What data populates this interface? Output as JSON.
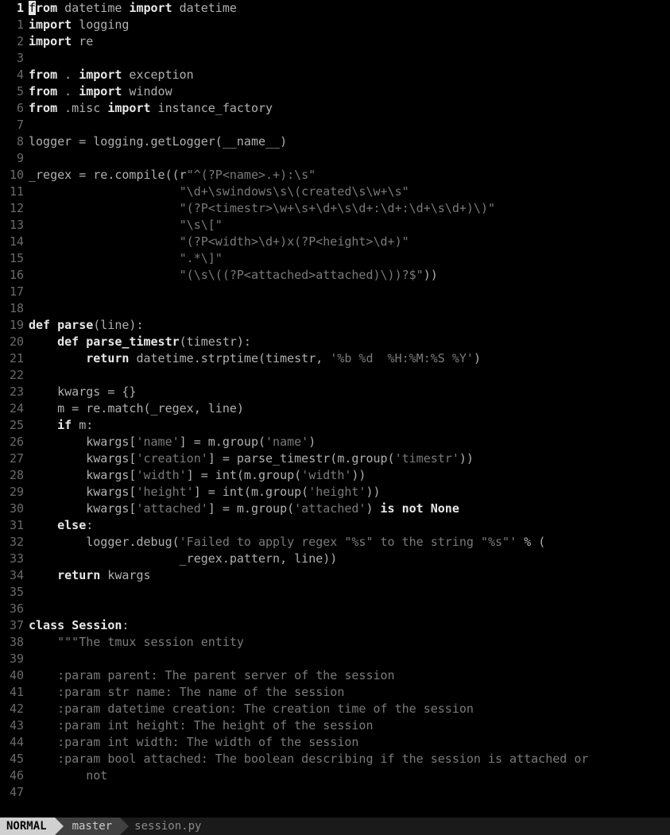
{
  "status": {
    "mode": "NORMAL",
    "branch_icon": "",
    "branch": "master",
    "filename": "session.py"
  },
  "cursor": {
    "line": 1,
    "col": 1
  },
  "lines": [
    {
      "num": 1,
      "current": true,
      "tokens": [
        {
          "c": "cursor",
          "t": "f"
        },
        {
          "c": "kw",
          "t": "rom"
        },
        {
          "c": "pun",
          "t": " datetime "
        },
        {
          "c": "kw",
          "t": "import"
        },
        {
          "c": "pun",
          "t": " datetime"
        }
      ]
    },
    {
      "num": 1,
      "tokens": [
        {
          "c": "kw",
          "t": "import"
        },
        {
          "c": "pun",
          "t": " logging"
        }
      ]
    },
    {
      "num": 2,
      "tokens": [
        {
          "c": "kw",
          "t": "import"
        },
        {
          "c": "pun",
          "t": " re"
        }
      ]
    },
    {
      "num": 3,
      "tokens": []
    },
    {
      "num": 4,
      "tokens": [
        {
          "c": "kw",
          "t": "from"
        },
        {
          "c": "pun",
          "t": " . "
        },
        {
          "c": "kw",
          "t": "import"
        },
        {
          "c": "pun",
          "t": " exception"
        }
      ]
    },
    {
      "num": 5,
      "tokens": [
        {
          "c": "kw",
          "t": "from"
        },
        {
          "c": "pun",
          "t": " . "
        },
        {
          "c": "kw",
          "t": "import"
        },
        {
          "c": "pun",
          "t": " window"
        }
      ]
    },
    {
      "num": 6,
      "tokens": [
        {
          "c": "kw",
          "t": "from"
        },
        {
          "c": "pun",
          "t": " .misc "
        },
        {
          "c": "kw",
          "t": "import"
        },
        {
          "c": "pun",
          "t": " instance_factory"
        }
      ]
    },
    {
      "num": 7,
      "tokens": []
    },
    {
      "num": 8,
      "tokens": [
        {
          "c": "id",
          "t": "logger = logging.getLogger(__name__)"
        }
      ]
    },
    {
      "num": 9,
      "tokens": []
    },
    {
      "num": 10,
      "tokens": [
        {
          "c": "id",
          "t": "_regex = re.compile((r"
        },
        {
          "c": "str",
          "t": "\"^(?P<name>.+):\\s\""
        }
      ]
    },
    {
      "num": 11,
      "tokens": [
        {
          "c": "id",
          "t": "                     "
        },
        {
          "c": "str",
          "t": "\"\\d+\\swindows\\s\\(created\\s\\w+\\s\""
        }
      ]
    },
    {
      "num": 12,
      "tokens": [
        {
          "c": "id",
          "t": "                     "
        },
        {
          "c": "str",
          "t": "\"(?P<timestr>\\w+\\s+\\d+\\s\\d+:\\d+:\\d+\\s\\d+)\\)\""
        }
      ]
    },
    {
      "num": 13,
      "tokens": [
        {
          "c": "id",
          "t": "                     "
        },
        {
          "c": "str",
          "t": "\"\\s\\[\""
        }
      ]
    },
    {
      "num": 14,
      "tokens": [
        {
          "c": "id",
          "t": "                     "
        },
        {
          "c": "str",
          "t": "\"(?P<width>\\d+)x(?P<height>\\d+)\""
        }
      ]
    },
    {
      "num": 15,
      "tokens": [
        {
          "c": "id",
          "t": "                     "
        },
        {
          "c": "str",
          "t": "\".*\\]\""
        }
      ]
    },
    {
      "num": 16,
      "tokens": [
        {
          "c": "id",
          "t": "                     "
        },
        {
          "c": "str",
          "t": "\"(\\s\\((?P<attached>attached)\\))?$\""
        },
        {
          "c": "id",
          "t": "))"
        }
      ]
    },
    {
      "num": 17,
      "tokens": []
    },
    {
      "num": 18,
      "tokens": []
    },
    {
      "num": 19,
      "tokens": [
        {
          "c": "kw",
          "t": "def"
        },
        {
          "c": "id",
          "t": " "
        },
        {
          "c": "fn",
          "t": "parse"
        },
        {
          "c": "id",
          "t": "(line):"
        }
      ]
    },
    {
      "num": 20,
      "tokens": [
        {
          "c": "id",
          "t": "    "
        },
        {
          "c": "kw",
          "t": "def"
        },
        {
          "c": "id",
          "t": " "
        },
        {
          "c": "fn",
          "t": "parse_timestr"
        },
        {
          "c": "id",
          "t": "(timestr):"
        }
      ]
    },
    {
      "num": 21,
      "tokens": [
        {
          "c": "id",
          "t": "        "
        },
        {
          "c": "kw",
          "t": "return"
        },
        {
          "c": "id",
          "t": " datetime.strptime(timestr, "
        },
        {
          "c": "str",
          "t": "'%b %d  %H:%M:%S %Y'"
        },
        {
          "c": "id",
          "t": ")"
        }
      ]
    },
    {
      "num": 22,
      "tokens": []
    },
    {
      "num": 23,
      "tokens": [
        {
          "c": "id",
          "t": "    kwargs = {}"
        }
      ]
    },
    {
      "num": 24,
      "tokens": [
        {
          "c": "id",
          "t": "    m = re.match(_regex, line)"
        }
      ]
    },
    {
      "num": 25,
      "tokens": [
        {
          "c": "id",
          "t": "    "
        },
        {
          "c": "kw",
          "t": "if"
        },
        {
          "c": "id",
          "t": " m:"
        }
      ]
    },
    {
      "num": 26,
      "tokens": [
        {
          "c": "id",
          "t": "        kwargs["
        },
        {
          "c": "str",
          "t": "'name'"
        },
        {
          "c": "id",
          "t": "] = m.group("
        },
        {
          "c": "str",
          "t": "'name'"
        },
        {
          "c": "id",
          "t": ")"
        }
      ]
    },
    {
      "num": 27,
      "tokens": [
        {
          "c": "id",
          "t": "        kwargs["
        },
        {
          "c": "str",
          "t": "'creation'"
        },
        {
          "c": "id",
          "t": "] = parse_timestr(m.group("
        },
        {
          "c": "str",
          "t": "'timestr'"
        },
        {
          "c": "id",
          "t": "))"
        }
      ]
    },
    {
      "num": 28,
      "tokens": [
        {
          "c": "id",
          "t": "        kwargs["
        },
        {
          "c": "str",
          "t": "'width'"
        },
        {
          "c": "id",
          "t": "] = int(m.group("
        },
        {
          "c": "str",
          "t": "'width'"
        },
        {
          "c": "id",
          "t": "))"
        }
      ]
    },
    {
      "num": 29,
      "tokens": [
        {
          "c": "id",
          "t": "        kwargs["
        },
        {
          "c": "str",
          "t": "'height'"
        },
        {
          "c": "id",
          "t": "] = int(m.group("
        },
        {
          "c": "str",
          "t": "'height'"
        },
        {
          "c": "id",
          "t": "))"
        }
      ]
    },
    {
      "num": 30,
      "tokens": [
        {
          "c": "id",
          "t": "        kwargs["
        },
        {
          "c": "str",
          "t": "'attached'"
        },
        {
          "c": "id",
          "t": "] = m.group("
        },
        {
          "c": "str",
          "t": "'attached'"
        },
        {
          "c": "id",
          "t": ") "
        },
        {
          "c": "kw",
          "t": "is not None"
        }
      ]
    },
    {
      "num": 31,
      "tokens": [
        {
          "c": "id",
          "t": "    "
        },
        {
          "c": "kw",
          "t": "else"
        },
        {
          "c": "id",
          "t": ":"
        }
      ]
    },
    {
      "num": 32,
      "tokens": [
        {
          "c": "id",
          "t": "        logger.debug("
        },
        {
          "c": "str",
          "t": "'Failed to apply regex \"%s\" to the string \"%s\"'"
        },
        {
          "c": "id",
          "t": " % ("
        }
      ]
    },
    {
      "num": 33,
      "tokens": [
        {
          "c": "id",
          "t": "                     _regex.pattern, line))"
        }
      ]
    },
    {
      "num": 34,
      "tokens": [
        {
          "c": "id",
          "t": "    "
        },
        {
          "c": "kw",
          "t": "return"
        },
        {
          "c": "id",
          "t": " kwargs"
        }
      ]
    },
    {
      "num": 35,
      "tokens": []
    },
    {
      "num": 36,
      "tokens": []
    },
    {
      "num": 37,
      "tokens": [
        {
          "c": "kw",
          "t": "class"
        },
        {
          "c": "id",
          "t": " "
        },
        {
          "c": "fn",
          "t": "Session"
        },
        {
          "c": "id",
          "t": ":"
        }
      ]
    },
    {
      "num": 38,
      "tokens": [
        {
          "c": "id",
          "t": "    "
        },
        {
          "c": "str",
          "t": "\"\"\"The tmux session entity"
        }
      ]
    },
    {
      "num": 39,
      "tokens": []
    },
    {
      "num": 40,
      "tokens": [
        {
          "c": "str",
          "t": "    :param parent: The parent server of the session"
        }
      ]
    },
    {
      "num": 41,
      "tokens": [
        {
          "c": "str",
          "t": "    :param str name: The name of the session"
        }
      ]
    },
    {
      "num": 42,
      "tokens": [
        {
          "c": "str",
          "t": "    :param datetime creation: The creation time of the session"
        }
      ]
    },
    {
      "num": 43,
      "tokens": [
        {
          "c": "str",
          "t": "    :param int height: The height of the session"
        }
      ]
    },
    {
      "num": 44,
      "tokens": [
        {
          "c": "str",
          "t": "    :param int width: The width of the session"
        }
      ]
    },
    {
      "num": 45,
      "tokens": [
        {
          "c": "str",
          "t": "    :param bool attached: The boolean describing if the session is attached or"
        }
      ]
    },
    {
      "num": 46,
      "tokens": [
        {
          "c": "str",
          "t": "        not"
        }
      ]
    },
    {
      "num": 47,
      "tokens": []
    }
  ]
}
